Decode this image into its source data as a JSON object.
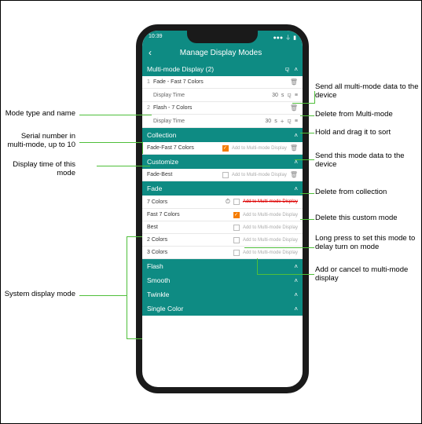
{
  "status": {
    "time": "10:39",
    "signal": "●●●",
    "wifi": "⏚",
    "battery": "▮"
  },
  "header": {
    "back": "‹",
    "title": "Manage Display Modes"
  },
  "multi": {
    "title": "Multi-mode Display (2)",
    "items": [
      {
        "serial": "1",
        "name": "Fade - Fast 7 Colors",
        "time_label": "Display Time",
        "time_value": "30",
        "unit": "s"
      },
      {
        "serial": "2",
        "name": "Flash - 7 Colors",
        "time_label": "Display Time",
        "time_value": "30",
        "unit": "s"
      }
    ]
  },
  "collection": {
    "title": "Collection",
    "items": [
      {
        "name": "Fade-Fast 7 Colors",
        "checked": true,
        "hint": "Add to Multi-mode Display"
      }
    ]
  },
  "customize": {
    "title": "Customize",
    "items": [
      {
        "name": "Fade-Best",
        "checked": false,
        "hint": "Add to Multi-mode Display"
      }
    ]
  },
  "fade": {
    "title": "Fade",
    "items": [
      {
        "name": "7 Colors",
        "clock": true,
        "redhint": "Add to Multi-mode Display"
      },
      {
        "name": "Fast 7 Colors",
        "checked": true,
        "hint": "Add to Multi-mode Display"
      },
      {
        "name": "Best",
        "checked": false,
        "hint": "Add to Multi-mode Display"
      },
      {
        "name": "2 Colors",
        "checked": false,
        "hint": "Add to Multi-mode Display"
      },
      {
        "name": "3 Colors",
        "checked": false,
        "hint": "Add to Multi-mode Display"
      }
    ]
  },
  "other_sections": [
    {
      "title": "Flash"
    },
    {
      "title": "Smooth"
    },
    {
      "title": "Twinkle"
    },
    {
      "title": "Single Color"
    }
  ],
  "annotations": {
    "l1": "Mode type and name",
    "l2": "Serial number in multi-mode, up to 10",
    "l3": "Display time of this mode",
    "l4": "System display mode",
    "r1": "Send all multi-mode data to the device",
    "r2": "Delete from Multi-mode",
    "r3": "Hold and drag it to sort",
    "r4": "Send this mode data to the device",
    "r5": "Delete from collection",
    "r6": "Delete this custom mode",
    "r7": "Long press to set this mode to delay turn on mode",
    "r8": "Add or cancel to multi-mode display"
  },
  "icons": {
    "bt": "⚼",
    "chev_up": "˄",
    "del": "🗑",
    "drag": "≡",
    "plus": "+",
    "clock": "⏱"
  }
}
